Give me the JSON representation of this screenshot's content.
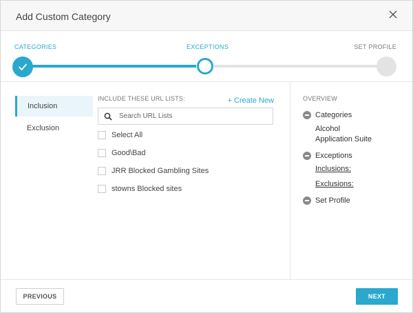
{
  "dialog": {
    "title": "Add Custom Category",
    "close_icon": "close-icon"
  },
  "stepper": {
    "steps": [
      {
        "label": "CATEGORIES",
        "state": "done"
      },
      {
        "label": "EXCEPTIONS",
        "state": "current"
      },
      {
        "label": "SET PROFILE",
        "state": "todo"
      }
    ],
    "accent": "#2aa8cd"
  },
  "leftnav": {
    "items": [
      {
        "label": "Inclusion",
        "active": true
      },
      {
        "label": "Exclusion",
        "active": false
      }
    ]
  },
  "urllists": {
    "heading": "INCLUDE THESE URL LISTS:",
    "create_new": "+ Create New",
    "search": {
      "placeholder": "Search URL Lists",
      "value": "",
      "icon": "search-icon"
    },
    "items": [
      {
        "label": "Select All",
        "checked": false
      },
      {
        "label": "Good\\Bad",
        "checked": false
      },
      {
        "label": "JRR Blocked Gambling Sites",
        "checked": false
      },
      {
        "label": "stowns Blocked sites",
        "checked": false
      }
    ]
  },
  "overview": {
    "heading": "OVERVIEW",
    "categories": {
      "title": "Categories",
      "items": [
        "Alcohol",
        "Application Suite"
      ]
    },
    "exceptions": {
      "title": "Exceptions",
      "inclusions": "Inclusions:",
      "exclusions": "Exclusions:"
    },
    "set_profile": {
      "title": "Set Profile"
    }
  },
  "footer": {
    "previous_label": "PREVIOUS",
    "next_label": "NEXT"
  }
}
